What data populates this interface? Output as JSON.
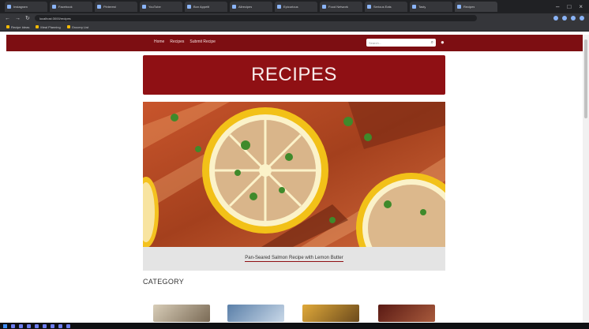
{
  "browser": {
    "tabs": [
      {
        "label": "Instagram"
      },
      {
        "label": "Facebook"
      },
      {
        "label": "Pinterest"
      },
      {
        "label": "YouTube"
      },
      {
        "label": "Bon Appetit"
      },
      {
        "label": "Allrecipes"
      },
      {
        "label": "Epicurious"
      },
      {
        "label": "Food Network"
      },
      {
        "label": "Serious Eats"
      },
      {
        "label": "Tasty"
      },
      {
        "label": "Recipes",
        "active": true
      }
    ],
    "url": "localhost:3000/recipes",
    "bookmarks": [
      "Recipe Ideas",
      "Meal Planning",
      "Grocery List"
    ]
  },
  "site": {
    "nav": {
      "links": [
        "Home",
        "Recipes",
        "Submit Recipe"
      ]
    },
    "search": {
      "placeholder": "Search..."
    },
    "hero": {
      "title": "RECIPES"
    },
    "feature": {
      "caption": "Pan-Seared Salmon Recipe with Lemon Butter"
    },
    "category": {
      "heading": "CATEGORY"
    },
    "categories": [
      {
        "icon": "thai-dish-image"
      },
      {
        "icon": "american-dish-image"
      },
      {
        "icon": "indian-dish-image"
      },
      {
        "icon": "mexican-dish-image"
      }
    ]
  },
  "colors": {
    "brand": "#7d0e12",
    "hero": "#8f1014",
    "caption_bg": "#e4e4e4"
  }
}
